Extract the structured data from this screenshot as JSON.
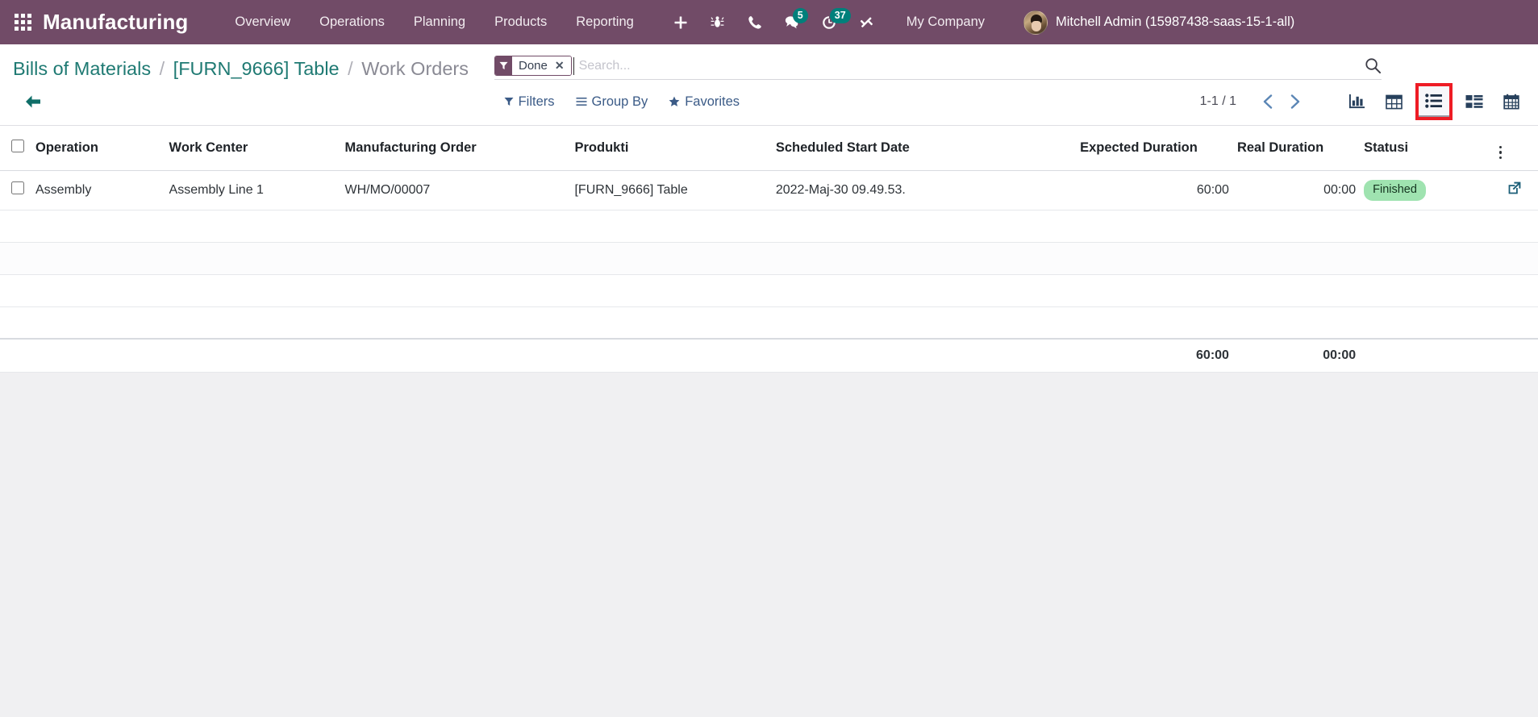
{
  "navbar": {
    "apps_icon": "apps-grid-icon",
    "brand": "Manufacturing",
    "menu": [
      {
        "label": "Overview"
      },
      {
        "label": "Operations"
      },
      {
        "label": "Planning"
      },
      {
        "label": "Products"
      },
      {
        "label": "Reporting"
      }
    ],
    "icons": [
      {
        "name": "plus-icon",
        "badge": null
      },
      {
        "name": "bug-icon",
        "badge": null
      },
      {
        "name": "phone-icon",
        "badge": null
      },
      {
        "name": "chat-icon",
        "badge": "5"
      },
      {
        "name": "activity-clock-icon",
        "badge": "37"
      },
      {
        "name": "tools-icon",
        "badge": null
      }
    ],
    "company": "My Company",
    "user": "Mitchell Admin (15987438-saas-15-1-all)",
    "accent_color": "#714B67",
    "badge_color": "#00807b"
  },
  "breadcrumb": {
    "root": "Bills of Materials",
    "sep": "/",
    "parent": "[FURN_9666] Table",
    "current": "Work Orders"
  },
  "search": {
    "facet_label": "Done",
    "facet_close": "✕",
    "placeholder": "Search...",
    "value": "",
    "magnifier": "search-icon"
  },
  "controls": {
    "back": "back-arrow-icon",
    "filters": "Filters",
    "group_by": "Group By",
    "favorites": "Favorites",
    "pager": "1-1 / 1",
    "prev": "previous-page-icon",
    "next": "next-page-icon",
    "views": [
      {
        "name": "graph-view",
        "icon": "bar-chart-icon",
        "active": false
      },
      {
        "name": "pivot-view",
        "icon": "pivot-table-icon",
        "active": false
      },
      {
        "name": "list-view",
        "icon": "list-icon",
        "active": true
      },
      {
        "name": "kanban-view",
        "icon": "kanban-icon",
        "active": false
      },
      {
        "name": "calendar-view",
        "icon": "calendar-icon",
        "active": false
      }
    ],
    "highlight_color": "#ee1c25"
  },
  "table": {
    "headers": [
      "Operation",
      "Work Center",
      "Manufacturing Order",
      "Produkti",
      "Scheduled Start Date",
      "Expected Duration",
      "Real Duration",
      "Statusi"
    ],
    "rows": [
      {
        "operation": "Assembly",
        "work_center": "Assembly Line 1",
        "manufacturing_order": "WH/MO/00007",
        "produkti": "[FURN_9666] Table",
        "scheduled_start_date": "2022-Maj-30 09.49.53.",
        "expected_duration": "60:00",
        "real_duration": "00:00",
        "statusi": "Finished",
        "open_icon": "external-link-icon"
      }
    ],
    "empty_rows": 4,
    "totals": {
      "expected_duration": "60:00",
      "real_duration": "00:00"
    },
    "status_badge_color": "#9fe3b0",
    "options_icon": "vertical-dots-icon"
  }
}
